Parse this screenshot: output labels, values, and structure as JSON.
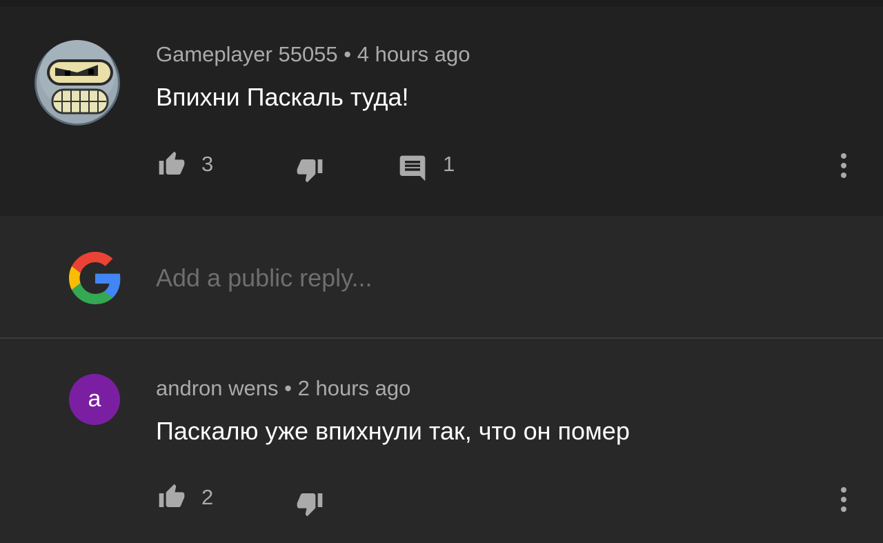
{
  "comments": [
    {
      "author": "Gameplayer 55055",
      "separator": "•",
      "time": "4 hours ago",
      "text": "Впихни Паскаль туда!",
      "likes": "3",
      "replies": "1",
      "avatar_icon": "bender-avatar-icon"
    },
    {
      "author": "andron wens",
      "separator": "•",
      "time": "2 hours ago",
      "text": "Паскалю уже впихнули так, что он помер",
      "likes": "2",
      "avatar_letter": "a",
      "avatar_color": "#7b1fa2"
    }
  ],
  "reply": {
    "placeholder": "Add a public reply...",
    "account_icon": "google-g-icon"
  },
  "colors": {
    "background": "#282828",
    "card": "#212121",
    "text": "#ffffff",
    "meta": "#aaaaaa",
    "placeholder": "#6e6e6e"
  }
}
